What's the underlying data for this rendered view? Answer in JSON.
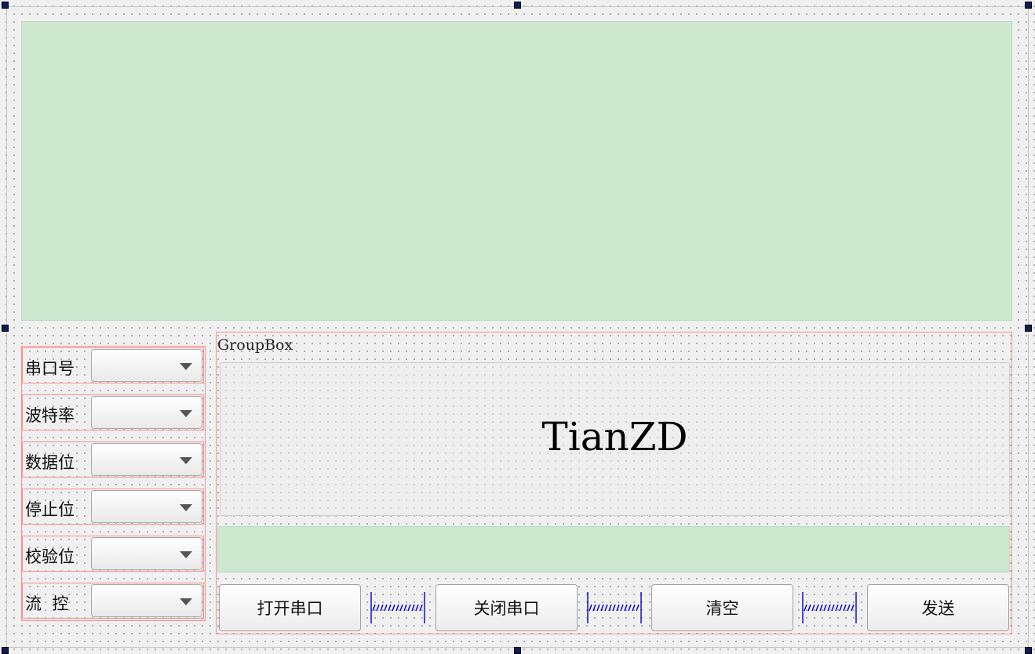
{
  "group_box": {
    "title": "GroupBox",
    "big_label": "TianZD"
  },
  "serial_settings": [
    {
      "label": "串口号",
      "selected": ""
    },
    {
      "label": "波特率",
      "selected": ""
    },
    {
      "label": "数据位",
      "selected": ""
    },
    {
      "label": "停止位",
      "selected": ""
    },
    {
      "label": "校验位",
      "selected": ""
    },
    {
      "label": "流  控",
      "selected": ""
    }
  ],
  "buttons": {
    "open_port": "打开串口",
    "close_port": "关闭串口",
    "clear": "清空",
    "send": "发送"
  },
  "colors": {
    "text_area_bg": "#cce9cf",
    "layout_frame": "#ff8c8c",
    "selection_handle": "#0a1e5a"
  }
}
